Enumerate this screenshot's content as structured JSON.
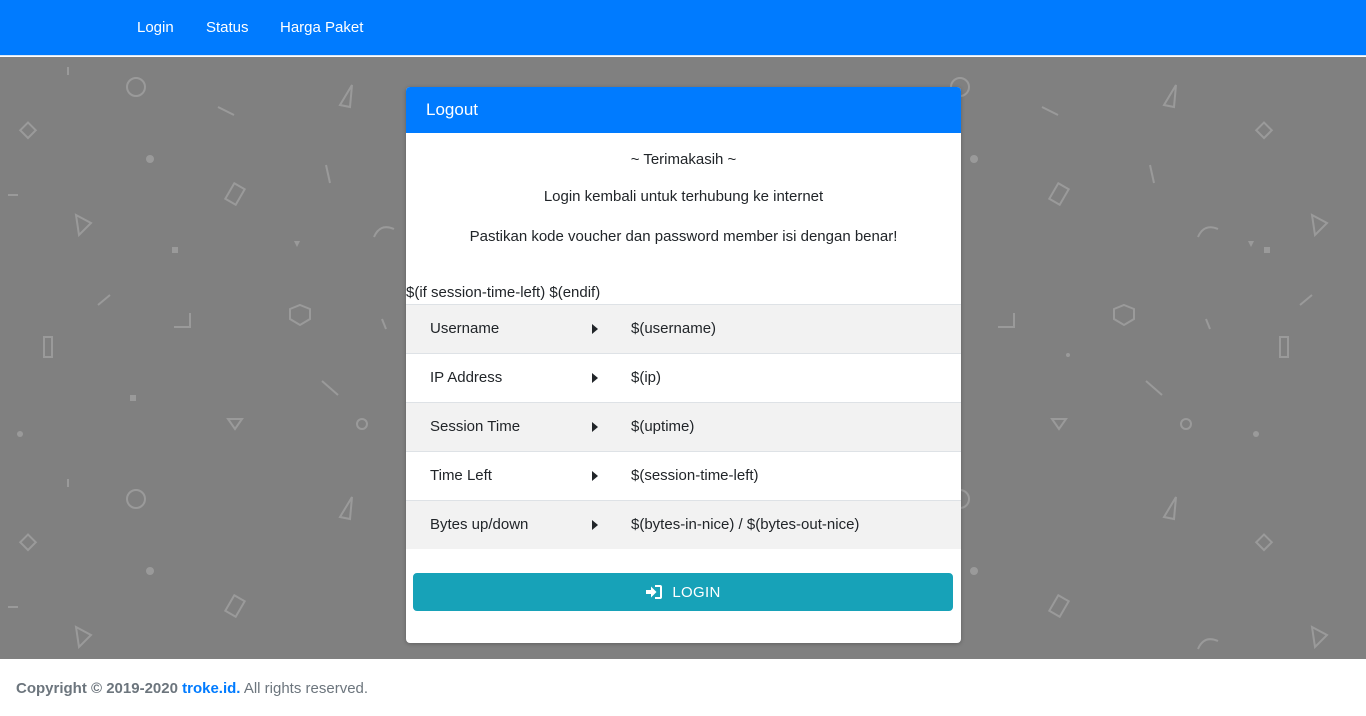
{
  "nav": {
    "items": [
      {
        "label": "Login"
      },
      {
        "label": "Status"
      },
      {
        "label": "Harga Paket"
      }
    ]
  },
  "card": {
    "header": "Logout",
    "messages": [
      "~ Terimakasih ~",
      "Login kembali untuk terhubung ke internet",
      "Pastikan kode voucher dan password member isi dengan benar!"
    ],
    "conditional": "$(if session-time-left) $(endif)",
    "rows": [
      {
        "label": "Username",
        "value": "$(username)"
      },
      {
        "label": "IP Address",
        "value": "$(ip)"
      },
      {
        "label": "Session Time",
        "value": "$(uptime)"
      },
      {
        "label": "Time Left",
        "value": "$(session-time-left)"
      },
      {
        "label": "Bytes up/down",
        "value": "$(bytes-in-nice) / $(bytes-out-nice)"
      }
    ],
    "login_button": "LOGIN",
    "login_icon": "sign-in-icon"
  },
  "footer": {
    "copyright": "Copyright © 2019-2020",
    "brand": "troke.id.",
    "rights": "All rights reserved."
  },
  "colors": {
    "primary": "#007bff",
    "button": "#17a2b8",
    "background": "#808080"
  }
}
